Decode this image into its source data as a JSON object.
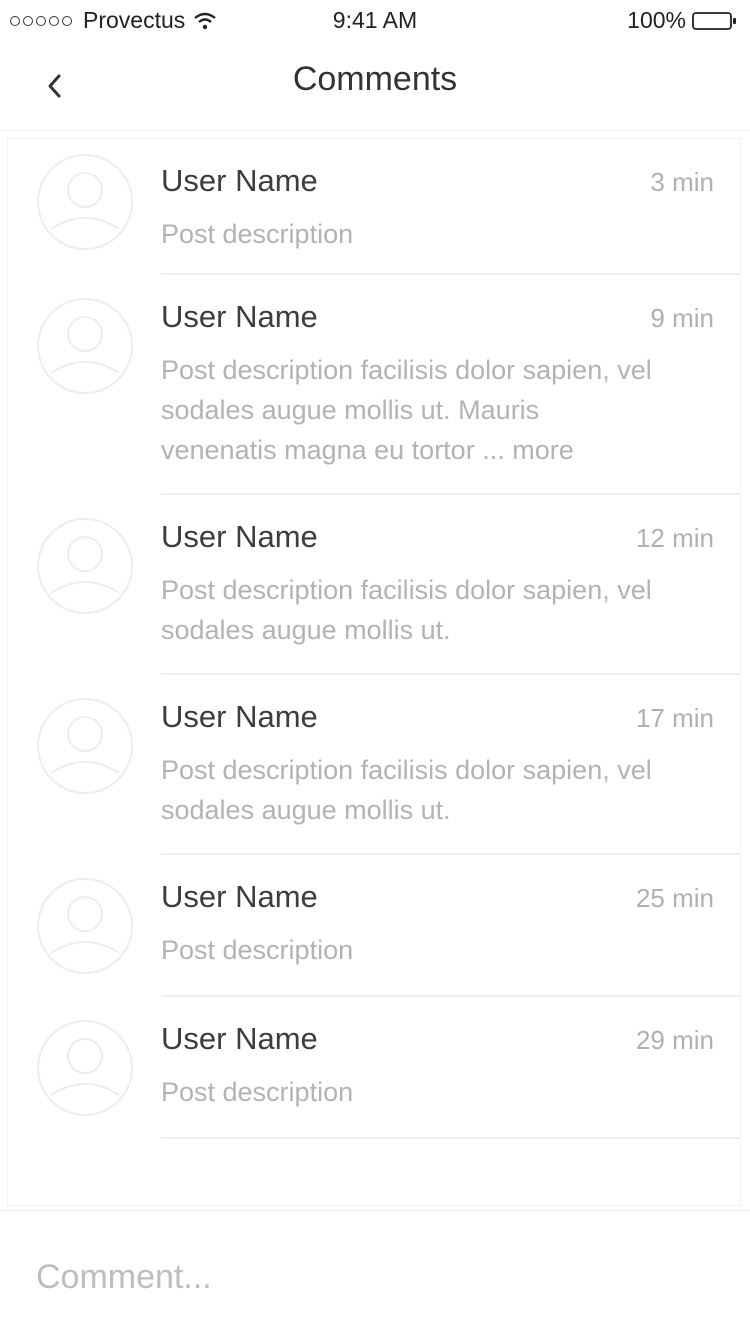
{
  "status_bar": {
    "carrier": "Provectus",
    "time": "9:41 AM",
    "battery": "100%"
  },
  "nav": {
    "title": "Comments",
    "back_icon": "chevron-left-icon"
  },
  "comments": [
    {
      "user": "User Name",
      "time": "3 min",
      "text": "Post description",
      "more": ""
    },
    {
      "user": "User Name",
      "time": "9 min",
      "text": "Post description facilisis dolor sapien, vel sodales augue mollis ut. Mauris venenatis magna eu tortor ...",
      "more": "more"
    },
    {
      "user": "User Name",
      "time": "12 min",
      "text": "Post description facilisis dolor sapien, vel sodales augue mollis ut.",
      "more": ""
    },
    {
      "user": "User Name",
      "time": "17 min",
      "text": "Post description facilisis dolor sapien, vel sodales augue mollis ut.",
      "more": ""
    },
    {
      "user": "User Name",
      "time": "25 min",
      "text": "Post description",
      "more": ""
    },
    {
      "user": "User Name",
      "time": "29 min",
      "text": "Post description",
      "more": ""
    }
  ],
  "composer": {
    "placeholder": "Comment...",
    "value": ""
  },
  "colors": {
    "text_dark": "#3d3d3d",
    "text_muted": "#b3b3b3",
    "divider": "#eeeeee",
    "avatar_stroke": "#ededed"
  }
}
